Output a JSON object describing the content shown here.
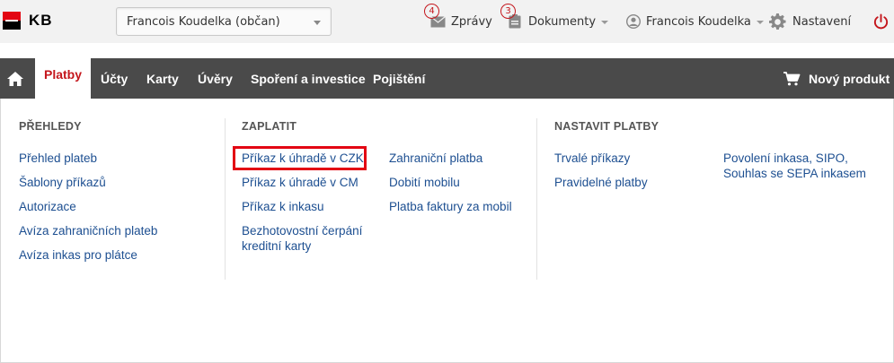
{
  "brand": {
    "logo_text": "KB"
  },
  "header": {
    "client_select": {
      "value": "Francois Koudelka (občan)"
    },
    "messages": {
      "label": "Zprávy",
      "count": "4"
    },
    "documents": {
      "label": "Dokumenty",
      "count": "3"
    },
    "user": {
      "label": "Francois Koudelka"
    },
    "settings": {
      "label": "Nastavení"
    }
  },
  "nav": {
    "items": [
      {
        "label": "Platby"
      },
      {
        "label": "Účty"
      },
      {
        "label": "Karty"
      },
      {
        "label": "Úvěry"
      },
      {
        "label": "Spoření a investice"
      },
      {
        "label": "Pojištění"
      }
    ],
    "new_product": "Nový produkt"
  },
  "menu": {
    "overview": {
      "heading": "PŘEHLEDY",
      "links": [
        "Přehled plateb",
        "Šablony příkazů",
        "Autorizace",
        "Avíza zahraničních plateb",
        "Avíza inkas pro plátce"
      ]
    },
    "pay": {
      "heading": "ZAPLATIT",
      "links_left": [
        "Příkaz k úhradě v CZK",
        "Příkaz k úhradě v CM",
        "Příkaz k inkasu",
        "Bezhotovostní čerpání kreditní karty"
      ],
      "links_right": [
        "Zahraniční platba",
        "Dobití mobilu",
        "Platba faktury za mobil"
      ]
    },
    "setup": {
      "heading": "NASTAVIT PLATBY",
      "links_left": [
        "Trvalé příkazy",
        "Pravidelné platby"
      ],
      "links_right": [
        "Povolení inkasa, SIPO, Souhlas se SEPA inkasem"
      ]
    }
  },
  "colors": {
    "brand_red": "#e30613",
    "nav_bg": "#4a4a4a",
    "link": "#1d4f91",
    "active": "#c4161c"
  }
}
